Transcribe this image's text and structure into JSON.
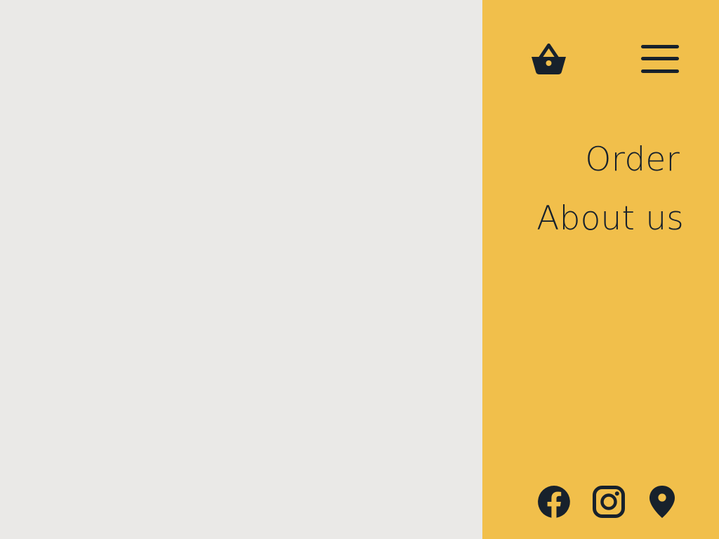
{
  "colors": {
    "page_background": "#EAE9E7",
    "panel_background": "#F1BF4B",
    "foreground": "#17212C"
  },
  "header": {
    "cart_icon": "basket-icon",
    "menu_icon": "hamburger-menu-icon"
  },
  "nav": {
    "items": [
      {
        "label": "Order"
      },
      {
        "label": "About us"
      }
    ]
  },
  "social": {
    "icons": [
      "facebook-icon",
      "instagram-icon",
      "location-pin-icon"
    ]
  }
}
